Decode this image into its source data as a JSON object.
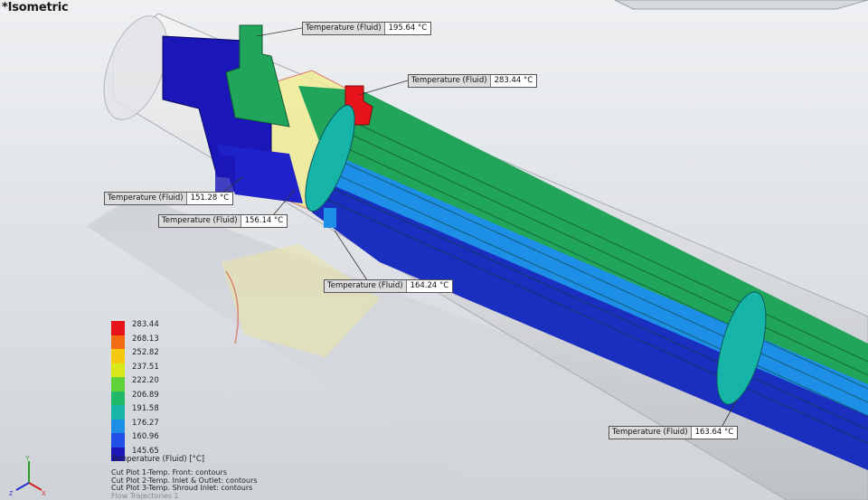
{
  "view": {
    "title": "*Isometric"
  },
  "probes": [
    {
      "label": "Temperature (Fluid)",
      "value": "195.64 °C"
    },
    {
      "label": "Temperature (Fluid)",
      "value": "283.44 °C"
    },
    {
      "label": "Temperature (Fluid)",
      "value": "151.28 °C"
    },
    {
      "label": "Temperature (Fluid)",
      "value": "156.14 °C"
    },
    {
      "label": "Temperature (Fluid)",
      "value": "164.24 °C"
    },
    {
      "label": "Temperature (Fluid)",
      "value": "163.64 °C"
    }
  ],
  "legend": {
    "values": [
      "283.44",
      "268.13",
      "252.82",
      "237.51",
      "222.20",
      "206.89",
      "191.58",
      "176.27",
      "160.96",
      "145.65"
    ],
    "colors": [
      "#e8141c",
      "#f26a12",
      "#f5c90f",
      "#d8e81a",
      "#5fd23a",
      "#22b86a",
      "#17b5a8",
      "#1e8fe6",
      "#2050e8",
      "#1a16b8"
    ],
    "title": "Temperature (Fluid) [°C]"
  },
  "plots": [
    "Cut Plot 1-Temp. Front: contours",
    "Cut Plot 2-Temp. Inlet & Outlet: contours",
    "Cut Plot 3-Temp. Shroud Inlet: contours",
    "Flow Trajectories 1"
  ],
  "triad": {
    "x": "X",
    "y": "Y",
    "z": "Z"
  }
}
